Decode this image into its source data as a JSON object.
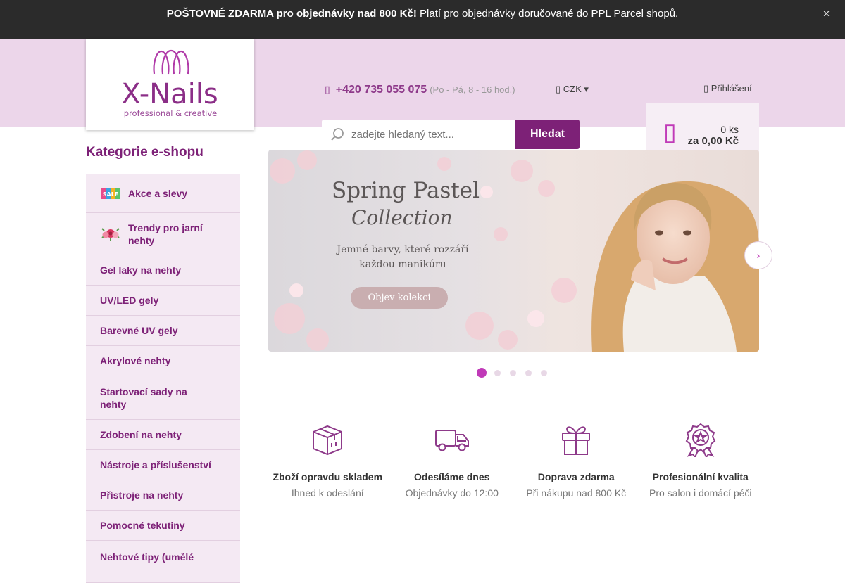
{
  "topbar": {
    "bold_text": "POŠTOVNÉ ZDARMA pro objednávky nad 800 Kč!",
    "text": " Platí pro objednávky doručované do PPL Parcel shopů.",
    "close_icon": "close-icon"
  },
  "header": {
    "logo_text": "X-Nails",
    "logo_tagline": "professional & creative",
    "phone": "+420 735 055 075",
    "hours": "(Po - Pá, 8 - 16 hod.)",
    "currency": "CZK",
    "login": "Přihlášení",
    "search_placeholder": "zadejte hledaný text...",
    "search_button": "Hledat",
    "cart_qty": "0 ks",
    "cart_total": "za 0,00 Kč"
  },
  "sidebar": {
    "title": "Kategorie e-shopu",
    "items": [
      {
        "label": "Akce a slevy",
        "icon": "sale-icon"
      },
      {
        "label": "Trendy pro jarní nehty",
        "icon": "flowers-icon"
      },
      {
        "label": "Gel laky na nehty"
      },
      {
        "label": "UV/LED gely"
      },
      {
        "label": "Barevné UV gely"
      },
      {
        "label": "Akrylové nehty"
      },
      {
        "label": "Startovací sady na nehty"
      },
      {
        "label": "Zdobení na nehty"
      },
      {
        "label": "Nástroje a příslušenství"
      },
      {
        "label": "Přístroje na nehty"
      },
      {
        "label": "Pomocné tekutiny"
      },
      {
        "label": "Nehtové tipy (umělé"
      }
    ]
  },
  "banner": {
    "title_line1": "Spring Pastel",
    "title_line2": "Collection",
    "subtitle": "Jemné barvy, které rozzáří každou manikúru",
    "cta": "Objev kolekci",
    "slides": 5,
    "active_slide": 1
  },
  "features": [
    {
      "title": "Zboží opravdu skladem",
      "subtitle": "Ihned k odeslání",
      "icon": "box-icon"
    },
    {
      "title": "Odesíláme dnes",
      "subtitle": "Objednávky do 12:00",
      "icon": "truck-icon"
    },
    {
      "title": "Doprava zdarma",
      "subtitle": "Při nákupu nad 800 Kč",
      "icon": "gift-icon"
    },
    {
      "title": "Profesionální kvalita",
      "subtitle": "Pro salon i domácí péči",
      "icon": "award-icon"
    }
  ],
  "colors": {
    "brand": "#7d2177",
    "accent": "#c03ab8",
    "header_bg": "#ecd6ea",
    "topbar_bg": "#2b2b2b"
  }
}
